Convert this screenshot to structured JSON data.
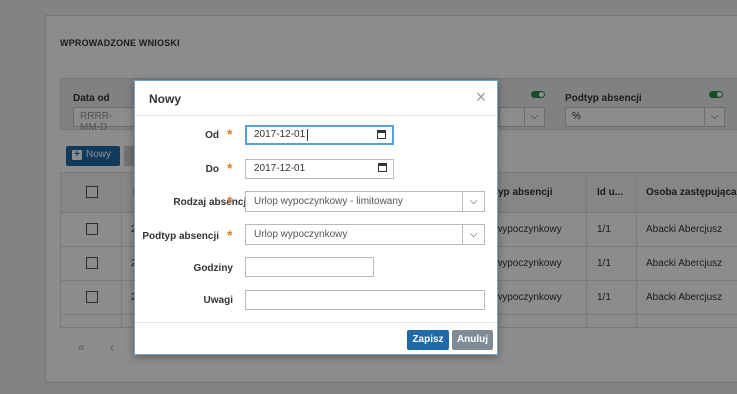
{
  "panel": {
    "title": "WPROWADZONE WNIOSKI"
  },
  "filters": {
    "date_from_label": "Data od",
    "date_from_placeholder": "RRRR-MM-D",
    "subtype_label": "Podtyp absencji",
    "subtype_value": "%"
  },
  "toolbar": {
    "new_label": "Nowy",
    "plus": "+"
  },
  "table": {
    "columns": [
      "I",
      "yp absencji",
      "Id u...",
      "Osoba zastępująca"
    ],
    "rows": [
      {
        "c1": "2",
        "type": "wypoczynkowy",
        "id": "1/1",
        "sub": "Abacki Abercjusz"
      },
      {
        "c1": "2",
        "type": "wypoczynkowy",
        "id": "1/1",
        "sub": "Abacki Abercjusz"
      },
      {
        "c1": "2",
        "type": "wypoczynkowy",
        "id": "1/1",
        "sub": "Abacki Abercjusz"
      }
    ]
  },
  "pager": {
    "first": "«",
    "prev": "‹"
  },
  "modal": {
    "title": "Nowy",
    "close": "×",
    "required_mark": "*",
    "fields": {
      "od_label": "Od",
      "od_value": "2017-12-01",
      "do_label": "Do",
      "do_value": "2017-12-01",
      "rodzaj_label": "Rodzaj absencji",
      "rodzaj_value": "Urlop wypoczynkowy - limitowany",
      "podtyp_label": "Podtyp absencji",
      "podtyp_value": "Urlop wypoczynkowy",
      "godziny_label": "Godziny",
      "godziny_value": "",
      "uwagi_label": "Uwagi",
      "uwagi_value": ""
    },
    "save_label": "Zapisz",
    "cancel_label": "Anuluj"
  },
  "colors": {
    "primary": "#1e6aa8",
    "required": "#e07b1c",
    "cancel": "#7f8c96",
    "toggle": "#2a8a4a"
  }
}
